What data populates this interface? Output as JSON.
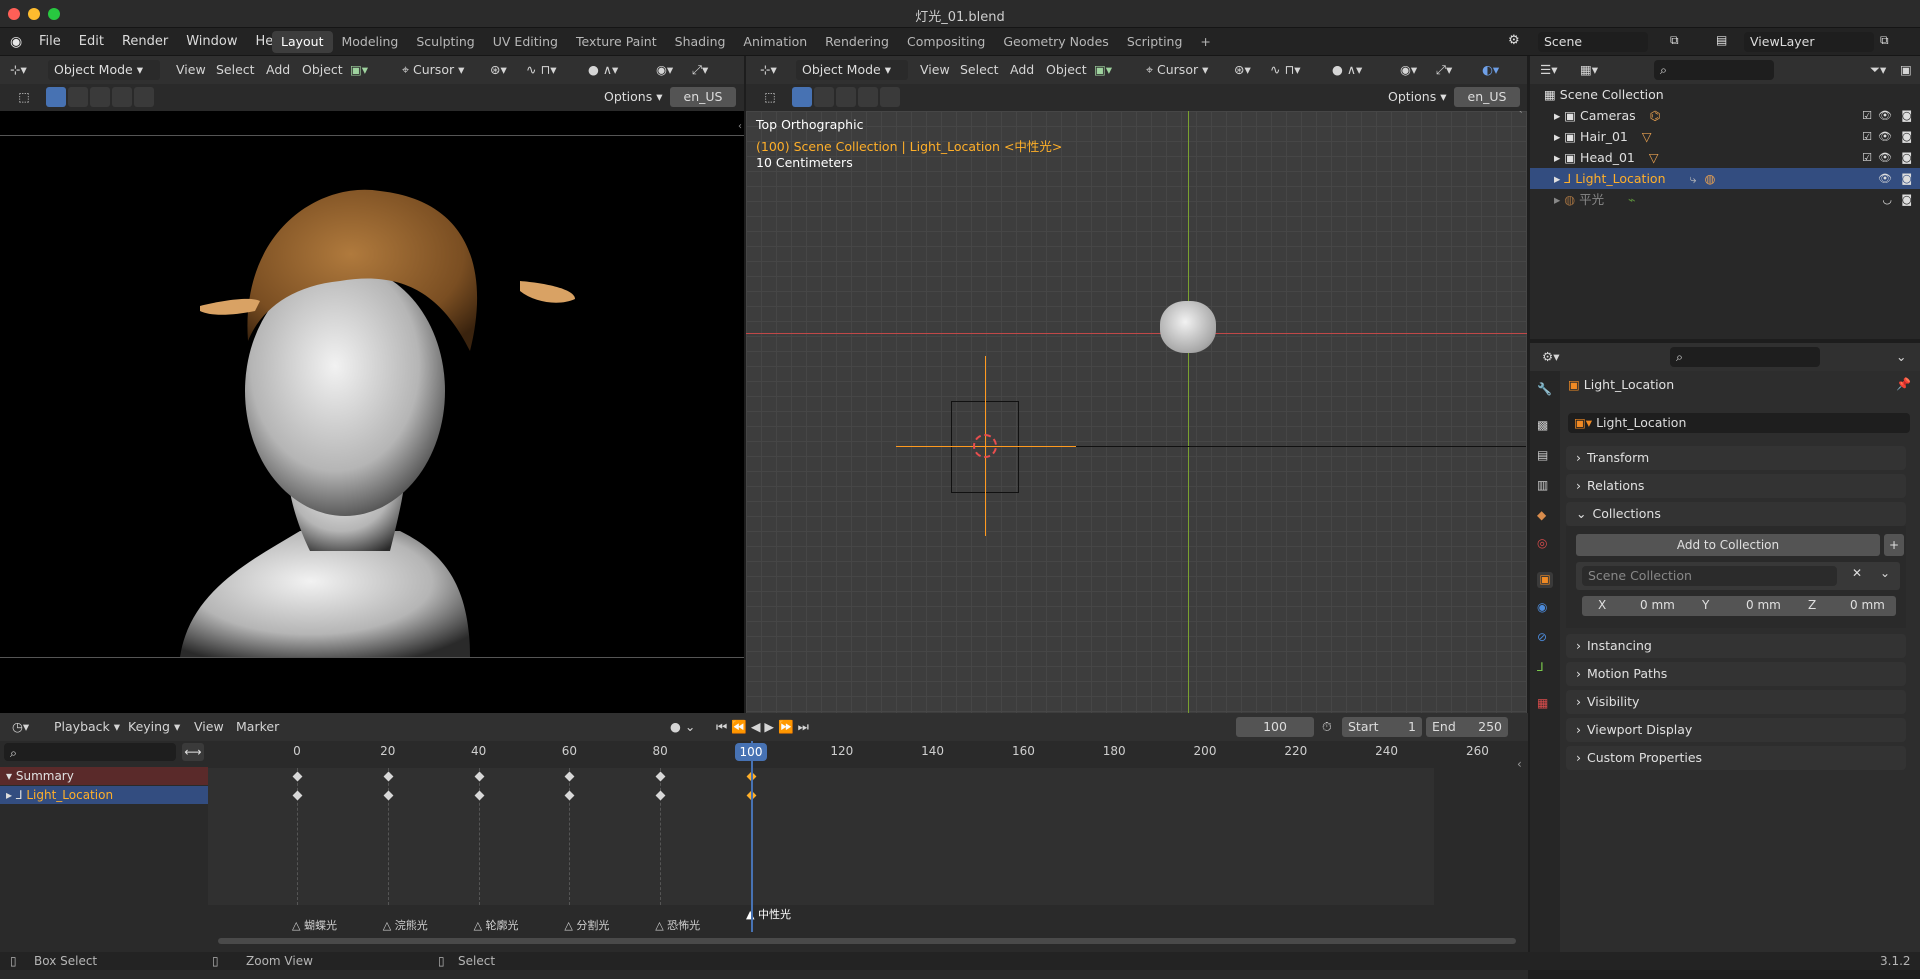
{
  "window": {
    "title": "灯光_01.blend"
  },
  "menus": [
    "File",
    "Edit",
    "Render",
    "Window",
    "Help"
  ],
  "workspaces": [
    "Layout",
    "Modeling",
    "Sculpting",
    "UV Editing",
    "Texture Paint",
    "Shading",
    "Animation",
    "Rendering",
    "Compositing",
    "Geometry Nodes",
    "Scripting"
  ],
  "active_workspace": "Layout",
  "scene": {
    "name": "Scene",
    "view_layer": "ViewLayer"
  },
  "left_viewport": {
    "mode": "Object Mode",
    "menus": [
      "View",
      "Select",
      "Add",
      "Object"
    ],
    "pivot": "Cursor",
    "options": "Options",
    "lang": "en_US"
  },
  "right_viewport": {
    "mode": "Object Mode",
    "menus": [
      "View",
      "Select",
      "Add",
      "Object"
    ],
    "pivot": "Cursor",
    "options": "Options",
    "lang": "en_US",
    "overlay_lines": [
      "Top Orthographic",
      "(100) Scene Collection | Light_Location <中性光>",
      "10 Centimeters"
    ]
  },
  "outliner": {
    "root": "Scene Collection",
    "items": [
      {
        "name": "Cameras",
        "selected": false
      },
      {
        "name": "Hair_01",
        "selected": false
      },
      {
        "name": "Head_01",
        "selected": false
      },
      {
        "name": "Light_Location",
        "selected": true
      },
      {
        "name": "平光",
        "selected": false
      }
    ]
  },
  "properties": {
    "object_name": "Light_Location",
    "data_name": "Light_Location",
    "panels": [
      "Transform",
      "Relations",
      "Collections",
      "Instancing",
      "Motion Paths",
      "Visibility",
      "Viewport Display",
      "Custom Properties"
    ],
    "add_to_collection": "Add to Collection",
    "collection_field": "Scene Collection",
    "offset": {
      "x_label": "X",
      "x": "0 mm",
      "y_label": "Y",
      "y": "0 mm",
      "z_label": "Z",
      "z": "0 mm"
    }
  },
  "timeline": {
    "menus": [
      "Playback",
      "Keying",
      "View",
      "Marker"
    ],
    "current_frame": "100",
    "start_label": "Start",
    "start": "1",
    "end_label": "End",
    "end": "250",
    "ticks": [
      "0",
      "20",
      "40",
      "60",
      "80",
      "100",
      "120",
      "140",
      "160",
      "180",
      "200",
      "220",
      "240",
      "260"
    ],
    "channels": [
      "Summary",
      "Light_Location"
    ],
    "markers": [
      "蝴蝶光",
      "浣熊光",
      "轮廓光",
      "分割光",
      "恐怖光",
      "中性光"
    ]
  },
  "status": {
    "left": "Box Select",
    "mid": "Zoom View",
    "right": "Select",
    "version": "3.1.2"
  },
  "colors": {
    "accent": "#4772b3",
    "highlight_text": "#ffaf29",
    "selected_row": "#334d80"
  }
}
